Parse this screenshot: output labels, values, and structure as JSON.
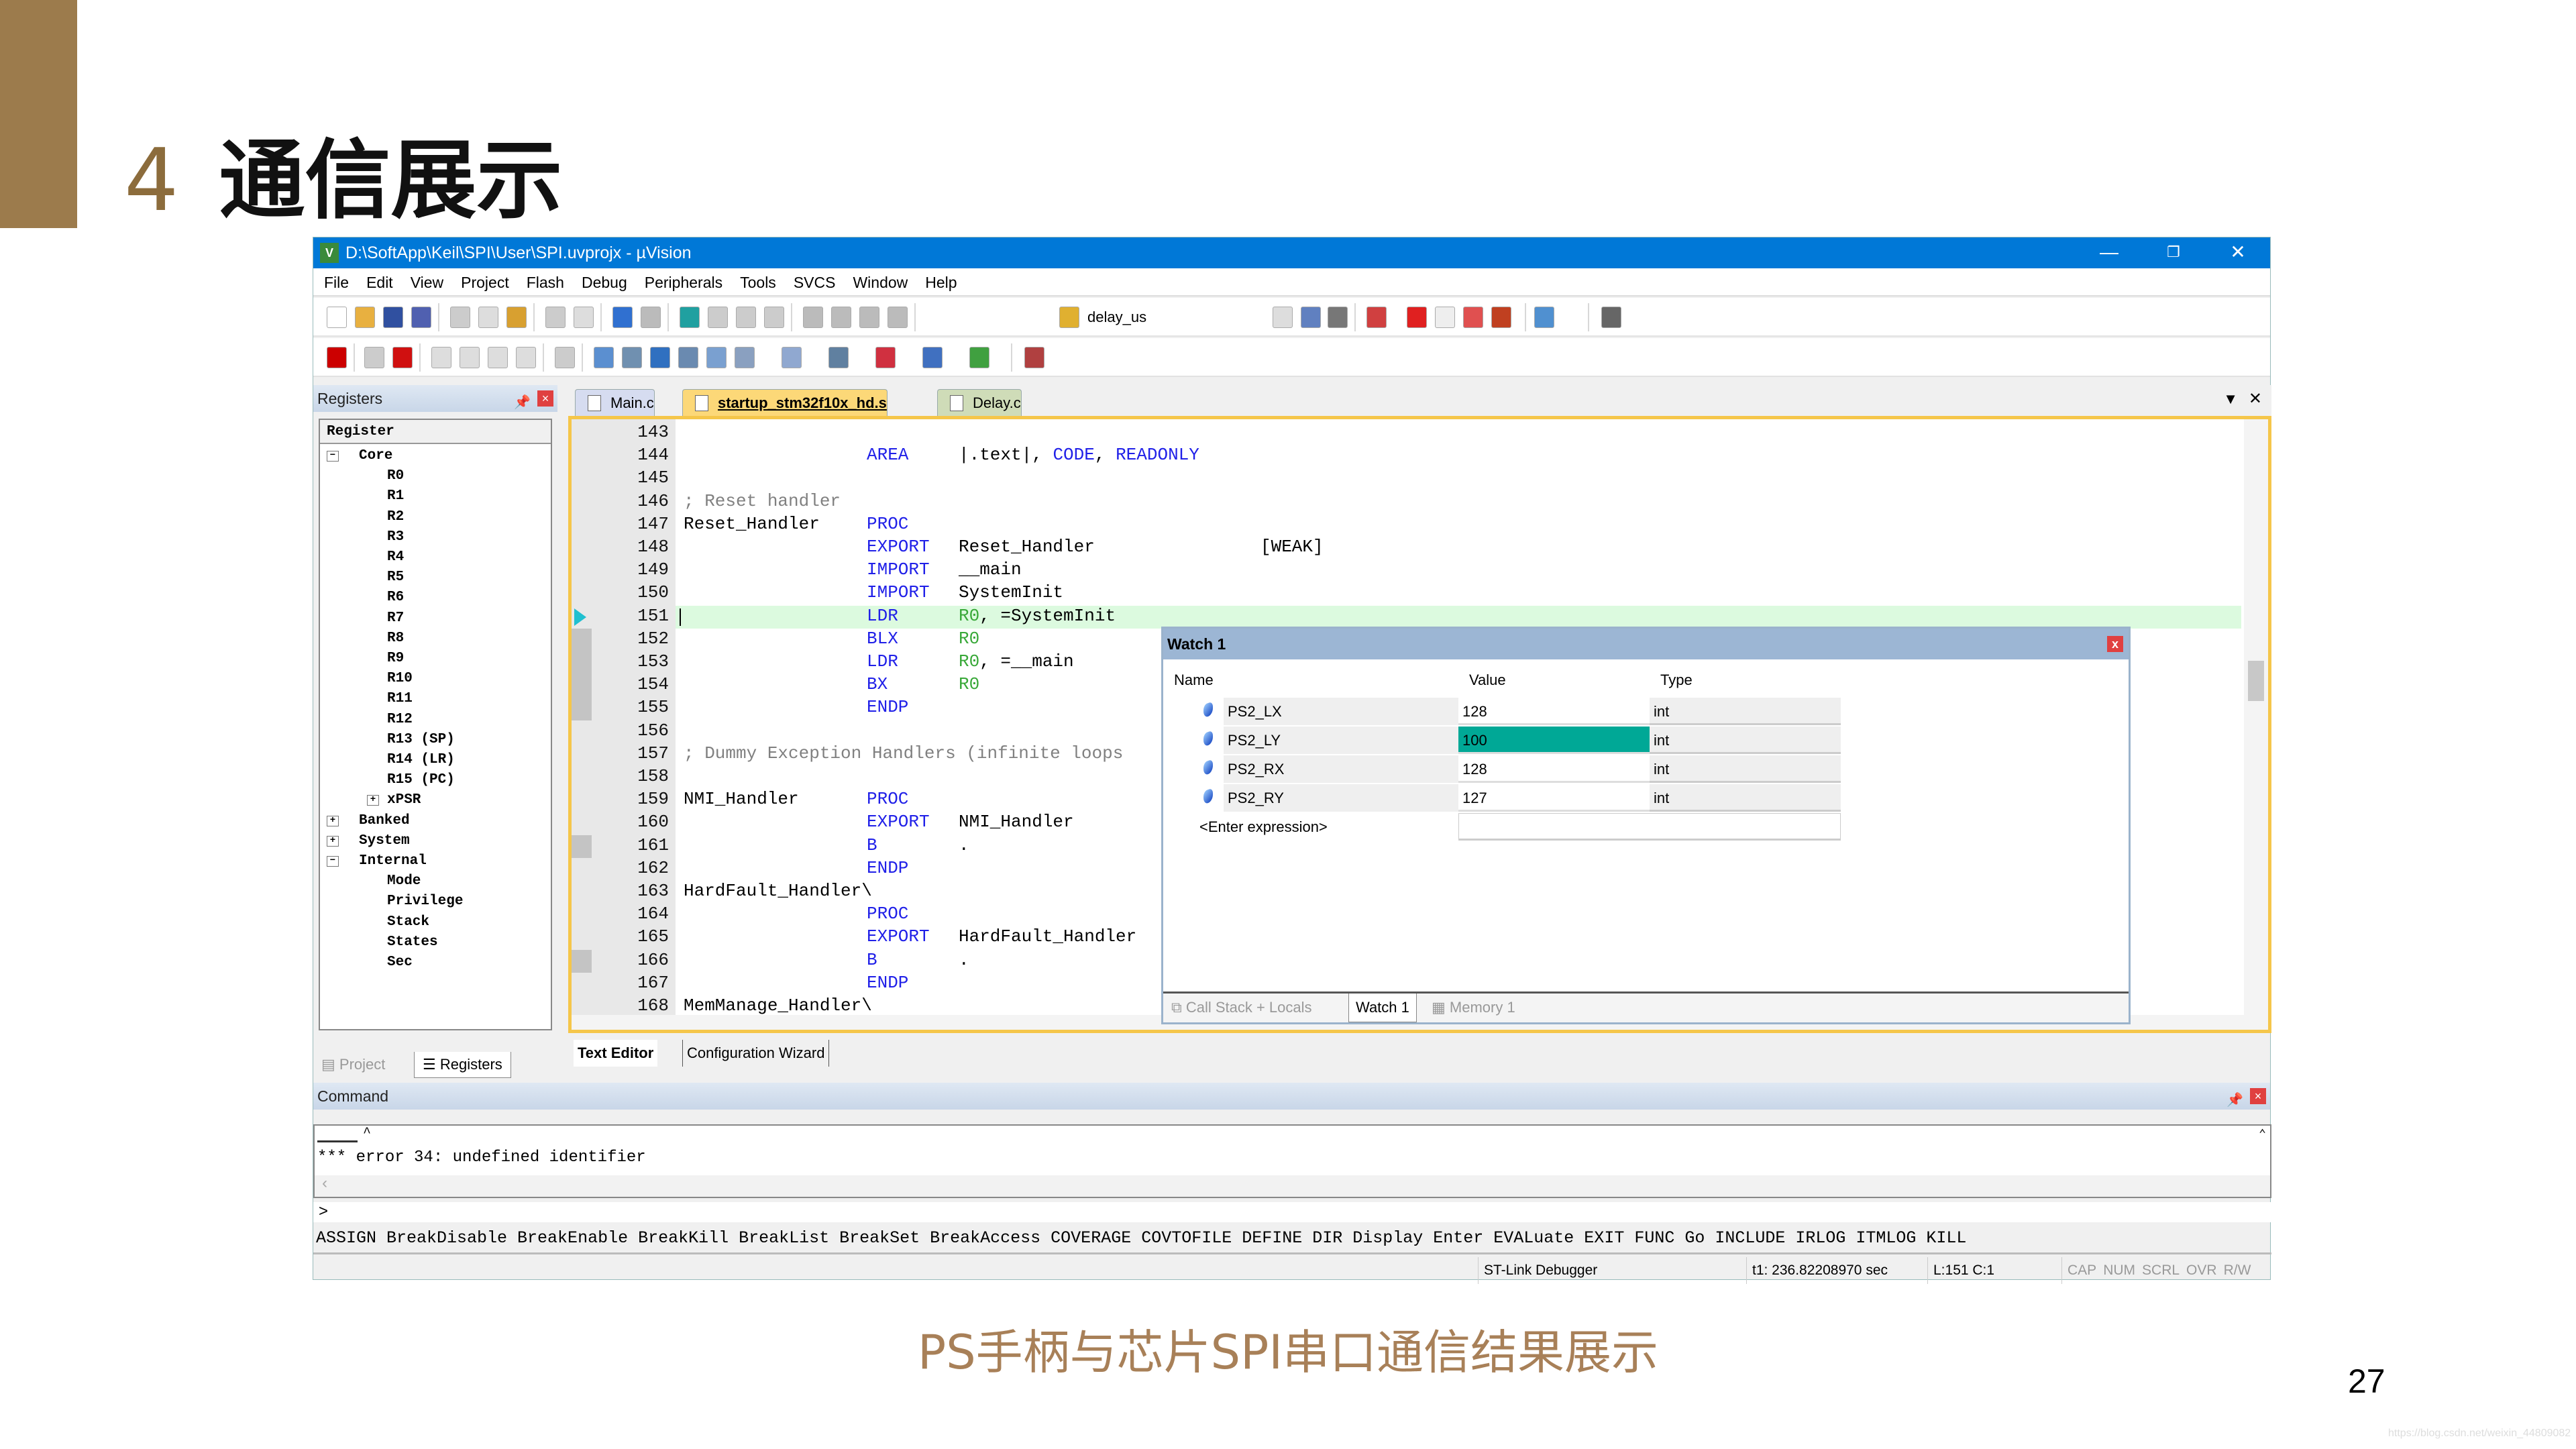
{
  "slide": {
    "number": "4",
    "title": "通信展示",
    "caption": "PS手柄与芯片SPI串口通信结果展示",
    "page": "27",
    "watermark": "https://blog.csdn.net/weixin_44809082",
    "accent": "#9c7b4c"
  },
  "window": {
    "title": "D:\\SoftApp\\Keil\\SPI\\User\\SPI.uvprojx - µVision",
    "app_icon": "V",
    "minimize": "—",
    "restore": "❐",
    "close": "✕"
  },
  "menu": [
    "File",
    "Edit",
    "View",
    "Project",
    "Flash",
    "Debug",
    "Peripherals",
    "Tools",
    "SVCS",
    "Window",
    "Help"
  ],
  "toolbar": {
    "find_value": "delay_us"
  },
  "registers": {
    "title": "Registers",
    "header": "Register",
    "nodes": [
      {
        "t": "Core",
        "lvl": 0,
        "tog": "−"
      },
      {
        "t": "R0",
        "lvl": 1
      },
      {
        "t": "R1",
        "lvl": 1
      },
      {
        "t": "R2",
        "lvl": 1
      },
      {
        "t": "R3",
        "lvl": 1
      },
      {
        "t": "R4",
        "lvl": 1
      },
      {
        "t": "R5",
        "lvl": 1
      },
      {
        "t": "R6",
        "lvl": 1
      },
      {
        "t": "R7",
        "lvl": 1
      },
      {
        "t": "R8",
        "lvl": 1
      },
      {
        "t": "R9",
        "lvl": 1
      },
      {
        "t": "R10",
        "lvl": 1
      },
      {
        "t": "R11",
        "lvl": 1
      },
      {
        "t": "R12",
        "lvl": 1
      },
      {
        "t": "R13 (SP)",
        "lvl": 1
      },
      {
        "t": "R14 (LR)",
        "lvl": 1
      },
      {
        "t": "R15 (PC)",
        "lvl": 1
      },
      {
        "t": "xPSR",
        "lvl": 1,
        "tog": "+"
      },
      {
        "t": "Banked",
        "lvl": 0,
        "tog": "+"
      },
      {
        "t": "System",
        "lvl": 0,
        "tog": "+"
      },
      {
        "t": "Internal",
        "lvl": 0,
        "tog": "−"
      },
      {
        "t": "Mode",
        "lvl": 1
      },
      {
        "t": "Privilege",
        "lvl": 1
      },
      {
        "t": "Stack",
        "lvl": 1
      },
      {
        "t": "States",
        "lvl": 1
      },
      {
        "t": "Sec",
        "lvl": 1
      }
    ],
    "tabs": [
      "Project",
      "Registers"
    ]
  },
  "doc_tabs": [
    {
      "label": "Main.c",
      "color": "#d6dcf0"
    },
    {
      "label": "startup_stm32f10x_hd.s",
      "color": "#fcd878",
      "active": true
    },
    {
      "label": "Delay.c",
      "color": "#cfdcb8"
    }
  ],
  "code": [
    {
      "n": "143"
    },
    {
      "n": "144",
      "op": "AREA",
      "a": [
        [
          "|.text|, ",
          ""
        ],
        [
          "CODE",
          "k"
        ],
        [
          ", ",
          ""
        ],
        [
          "READONLY",
          "k"
        ]
      ]
    },
    {
      "n": "145"
    },
    {
      "n": "146",
      "cm": "; Reset handler"
    },
    {
      "n": "147",
      "lb": "Reset_Handler",
      "op": "PROC"
    },
    {
      "n": "148",
      "op": "EXPORT",
      "a": [
        [
          "Reset_Handler",
          ""
        ]
      ],
      "x": "[WEAK]"
    },
    {
      "n": "149",
      "op": "IMPORT",
      "a": [
        [
          "__main",
          ""
        ]
      ]
    },
    {
      "n": "150",
      "op": "IMPORT",
      "a": [
        [
          "SystemInit",
          ""
        ]
      ]
    },
    {
      "n": "151",
      "op": "LDR",
      "a": [
        [
          "R0",
          "r"
        ],
        [
          ", =SystemInit",
          ""
        ]
      ],
      "cur": true
    },
    {
      "n": "152",
      "op": "BLX",
      "a": [
        [
          "R0",
          "r"
        ]
      ]
    },
    {
      "n": "153",
      "op": "LDR",
      "a": [
        [
          "R0",
          "r"
        ],
        [
          ", =__main",
          ""
        ]
      ]
    },
    {
      "n": "154",
      "op": "BX",
      "a": [
        [
          "R0",
          "r"
        ]
      ]
    },
    {
      "n": "155",
      "op": "ENDP"
    },
    {
      "n": "156"
    },
    {
      "n": "157",
      "cm": "; Dummy Exception Handlers (infinite loops"
    },
    {
      "n": "158"
    },
    {
      "n": "159",
      "lb": "NMI_Handler",
      "op": "PROC"
    },
    {
      "n": "160",
      "op": "EXPORT",
      "a": [
        [
          "NMI_Handler",
          ""
        ]
      ]
    },
    {
      "n": "161",
      "op": "B",
      "a": [
        [
          ".",
          ""
        ]
      ]
    },
    {
      "n": "162",
      "op": "ENDP"
    },
    {
      "n": "163",
      "lb": "HardFault_Handler\\"
    },
    {
      "n": "164",
      "op": "PROC"
    },
    {
      "n": "165",
      "op": "EXPORT",
      "a": [
        [
          "HardFault_Handler",
          ""
        ]
      ]
    },
    {
      "n": "166",
      "op": "B",
      "a": [
        [
          ".",
          ""
        ]
      ]
    },
    {
      "n": "167",
      "op": "ENDP"
    },
    {
      "n": "168",
      "lb": "MemManage_Handler\\"
    }
  ],
  "watch": {
    "title": "Watch 1",
    "columns": [
      "Name",
      "Value",
      "Type"
    ],
    "rows": [
      {
        "name": "PS2_LX",
        "value": "128",
        "type": "int"
      },
      {
        "name": "PS2_LY",
        "value": "100",
        "type": "int",
        "changed": true
      },
      {
        "name": "PS2_RX",
        "value": "128",
        "type": "int"
      },
      {
        "name": "PS2_RY",
        "value": "127",
        "type": "int"
      }
    ],
    "enter": "<Enter expression>",
    "changed_color": "#00a896",
    "tabs": [
      "Call Stack + Locals",
      "Watch 1",
      "Memory 1"
    ]
  },
  "editor_tabs": [
    "Text Editor",
    "Configuration Wizard"
  ],
  "command": {
    "title": "Command",
    "caret": "^",
    "output": "*** error 34: undefined identifier",
    "prompt": ">",
    "list": "ASSIGN BreakDisable BreakEnable BreakKill BreakList BreakSet BreakAccess COVERAGE COVTOFILE DEFINE DIR Display Enter EVALuate EXIT FUNC Go INCLUDE IRLOG ITMLOG KILL"
  },
  "status": {
    "debugger": "ST-Link Debugger",
    "time": "t1: 236.82208970 sec",
    "pos": "L:151 C:1",
    "flags": [
      "CAP",
      "NUM",
      "SCRL",
      "OVR",
      "R/W"
    ]
  }
}
